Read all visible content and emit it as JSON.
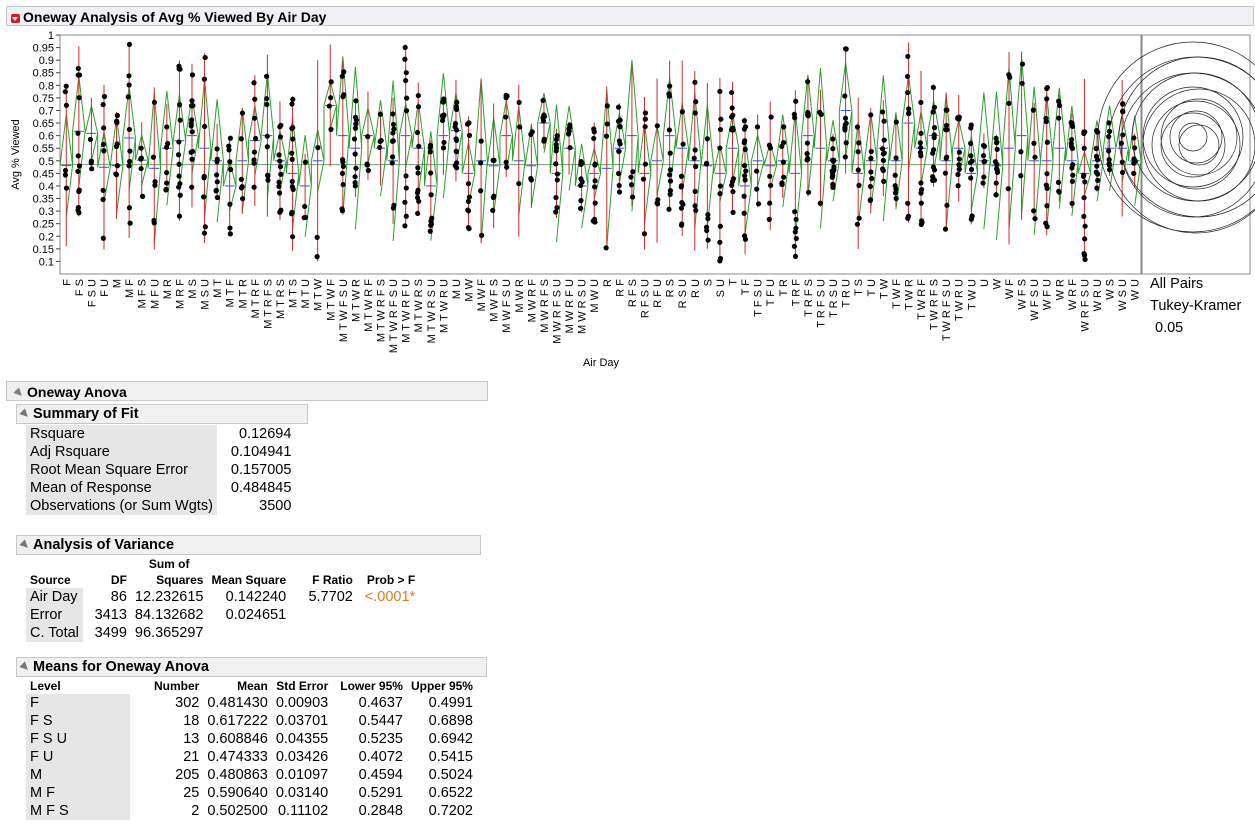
{
  "title": "Oneway Analysis of Avg % Viewed By Air Day",
  "chart_data": {
    "type": "scatter",
    "xlabel": "Air Day",
    "ylabel": "Avg % Viewed",
    "ylim": [
      0.05,
      1.0
    ],
    "yticks": [
      "0.1",
      "0.15",
      "0.2",
      "0.25",
      "0.3",
      "0.35",
      "0.4",
      "0.45",
      "0.5",
      "0.55",
      "0.6",
      "0.65",
      "0.7",
      "0.75",
      "0.8",
      "0.85",
      "0.9",
      "0.95",
      "1"
    ],
    "grand_mean": 0.484845,
    "categories": [
      "F",
      "F S",
      "F S U",
      "F U",
      "M",
      "M F",
      "M F S",
      "M F U",
      "M R",
      "M R F",
      "M S",
      "M S U",
      "M T",
      "M T F",
      "M T R",
      "M T R F",
      "M T R F S",
      "M T R S",
      "M T S",
      "M T U",
      "M T W",
      "M T W F",
      "M T W F S U",
      "M T W R",
      "M T W R F",
      "M T W R F S",
      "M T W R F S U",
      "M T W R F U",
      "M T W R S",
      "M T W R S U",
      "M T W R U",
      "M U",
      "M W",
      "M W F",
      "M W F S",
      "M W F S U",
      "M W R",
      "M W R F",
      "M W R F S",
      "M W R F S U",
      "M W R F U",
      "M W R S U",
      "M W U",
      "R",
      "R F",
      "R F S",
      "R F S U",
      "R F U",
      "R S",
      "R S U",
      "R U",
      "S",
      "S U",
      "T",
      "T F",
      "T F S U",
      "T F U",
      "T R",
      "T R F",
      "T R F S",
      "T R F S U",
      "T R S U",
      "T R U",
      "T S",
      "T U",
      "T W",
      "T W F",
      "T W R",
      "T W R F",
      "T W R F S",
      "T W R F S U",
      "T W R U",
      "T W U",
      "U",
      "W",
      "W F",
      "W F S",
      "W F S U",
      "W F U",
      "W R",
      "W R F",
      "W R F S U",
      "W R U",
      "W S",
      "W S U",
      "W U"
    ],
    "means": [
      0.48143,
      0.617222,
      0.608846,
      0.474333,
      0.480863,
      0.59064,
      0.5025,
      0.47,
      0.55,
      0.58,
      0.6,
      0.55,
      0.5,
      0.4,
      0.5,
      0.58,
      0.6,
      0.5,
      0.45,
      0.4,
      0.5,
      0.72,
      0.6,
      0.55,
      0.6,
      0.55,
      0.5,
      0.6,
      0.55,
      0.4,
      0.6,
      0.62,
      0.45,
      0.5,
      0.48,
      0.6,
      0.5,
      0.48,
      0.65,
      0.45,
      0.55,
      0.4,
      0.45,
      0.47,
      0.55,
      0.6,
      0.45,
      0.5,
      0.6,
      0.55,
      0.5,
      0.48,
      0.45,
      0.55,
      0.4,
      0.5,
      0.48,
      0.5,
      0.45,
      0.6,
      0.55,
      0.5,
      0.7,
      0.45,
      0.5,
      0.55,
      0.5,
      0.65,
      0.55,
      0.6,
      0.5,
      0.55,
      0.45,
      0.5,
      0.48,
      0.55,
      0.6,
      0.5,
      0.5,
      0.55,
      0.5,
      0.45,
      0.5,
      0.55,
      0.55,
      0.5,
      0.5
    ],
    "compare_label": "All Pairs",
    "compare_method": "Tukey-Kramer",
    "alpha": "0.05"
  },
  "anova": {
    "title": "Oneway Anova",
    "summary": {
      "title": "Summary of Fit",
      "rows": [
        {
          "label": "Rsquare",
          "value": "0.12694"
        },
        {
          "label": "Adj Rsquare",
          "value": "0.104941"
        },
        {
          "label": "Root Mean Square Error",
          "value": "0.157005"
        },
        {
          "label": "Mean of Response",
          "value": "0.484845"
        },
        {
          "label": "Observations (or Sum Wgts)",
          "value": "3500"
        }
      ]
    },
    "variance": {
      "title": "Analysis of Variance",
      "headers": {
        "source": "Source",
        "df": "DF",
        "ss_top": "Sum of",
        "ss": "Squares",
        "ms": "Mean Square",
        "f": "F Ratio",
        "p": "Prob > F"
      },
      "rows": [
        {
          "source": "Air Day",
          "df": "86",
          "ss": "12.232615",
          "ms": "0.142240",
          "f": "5.7702",
          "p": "<.0001*"
        },
        {
          "source": "Error",
          "df": "3413",
          "ss": "84.132682",
          "ms": "0.024651",
          "f": "",
          "p": ""
        },
        {
          "source": "C. Total",
          "df": "3499",
          "ss": "96.365297",
          "ms": "",
          "f": "",
          "p": ""
        }
      ]
    },
    "means_table": {
      "title": "Means for Oneway Anova",
      "headers": {
        "level": "Level",
        "number": "Number",
        "mean": "Mean",
        "se": "Std Error",
        "lower": "Lower 95%",
        "upper": "Upper 95%"
      },
      "rows": [
        {
          "level": "F",
          "number": "302",
          "mean": "0.481430",
          "se": "0.00903",
          "lower": "0.4637",
          "upper": "0.4991"
        },
        {
          "level": "F S",
          "number": "18",
          "mean": "0.617222",
          "se": "0.03701",
          "lower": "0.5447",
          "upper": "0.6898"
        },
        {
          "level": "F S U",
          "number": "13",
          "mean": "0.608846",
          "se": "0.04355",
          "lower": "0.5235",
          "upper": "0.6942"
        },
        {
          "level": "F U",
          "number": "21",
          "mean": "0.474333",
          "se": "0.03426",
          "lower": "0.4072",
          "upper": "0.5415"
        },
        {
          "level": "M",
          "number": "205",
          "mean": "0.480863",
          "se": "0.01097",
          "lower": "0.4594",
          "upper": "0.5024"
        },
        {
          "level": "M F",
          "number": "25",
          "mean": "0.590640",
          "se": "0.03140",
          "lower": "0.5291",
          "upper": "0.6522"
        },
        {
          "level": "M F S",
          "number": "2",
          "mean": "0.502500",
          "se": "0.11102",
          "lower": "0.2848",
          "upper": "0.7202"
        }
      ]
    }
  },
  "colors": {
    "mean_line": "#7a9a7a",
    "diamond": "#2ca02c",
    "point": "#000000",
    "error_bar": "#d62728",
    "quantile": "#3355cc",
    "highlight": "#e07a1f"
  }
}
